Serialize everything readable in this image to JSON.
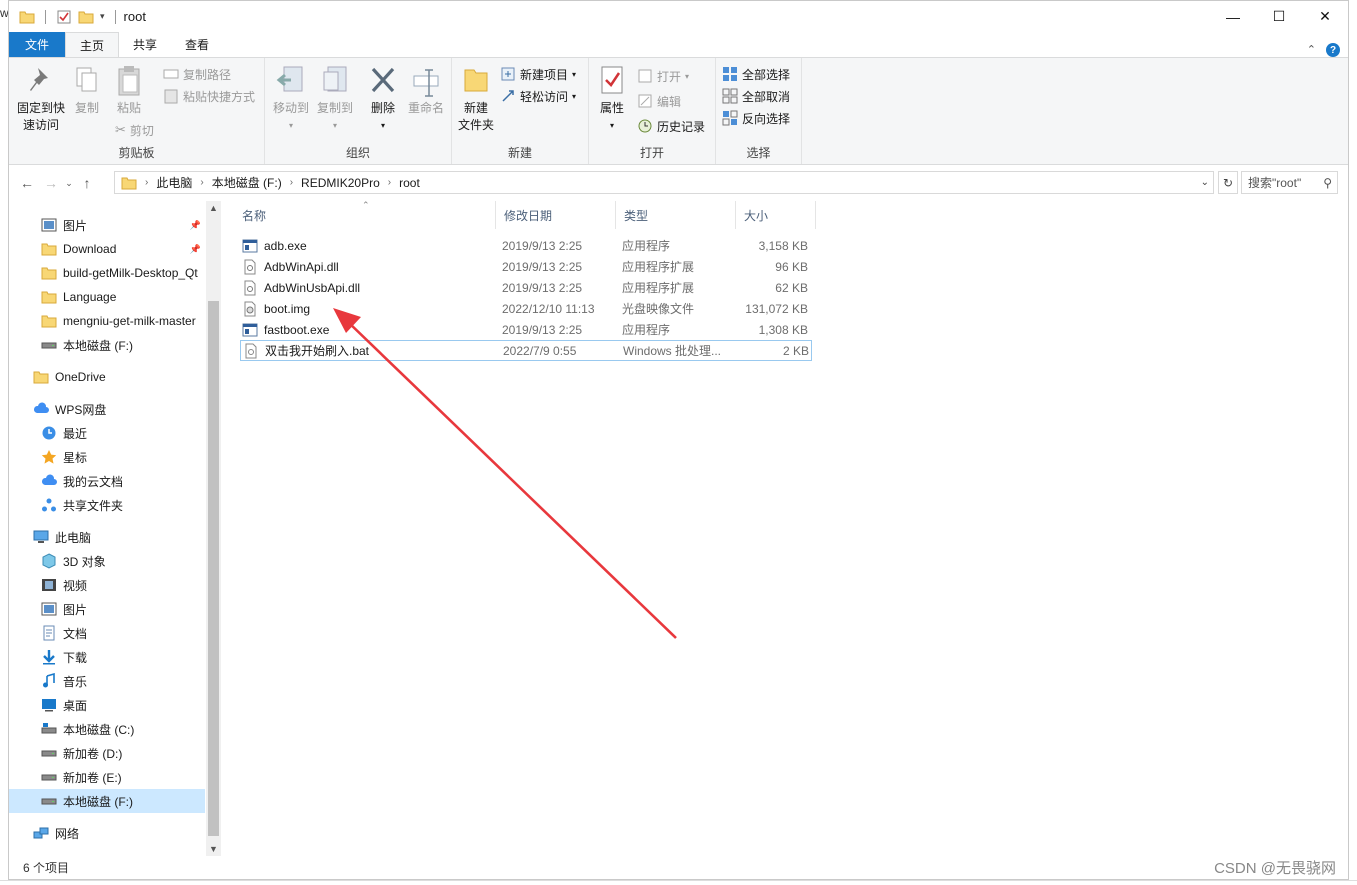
{
  "window": {
    "title": "root",
    "edge_letter": "w"
  },
  "tabs": {
    "file": "文件",
    "home": "主页",
    "share": "共享",
    "view": "查看",
    "help_glyph": "?"
  },
  "ribbon": {
    "clipboard": {
      "label": "剪贴板",
      "pin": "固定到快\n速访问",
      "pin_l1": "固定到快",
      "pin_l2": "速访问",
      "copy": "复制",
      "paste": "粘贴",
      "copy_path": "复制路径",
      "paste_shortcut": "粘贴快捷方式",
      "cut": "剪切"
    },
    "organize": {
      "label": "组织",
      "move_to": "移动到",
      "copy_to": "复制到",
      "delete": "删除",
      "rename": "重命名"
    },
    "new": {
      "label": "新建",
      "new_folder_l1": "新建",
      "new_folder_l2": "文件夹",
      "new_item": "新建项目",
      "easy_access": "轻松访问"
    },
    "open": {
      "label": "打开",
      "properties": "属性",
      "open": "打开",
      "edit": "编辑",
      "history": "历史记录"
    },
    "select": {
      "label": "选择",
      "select_all": "全部选择",
      "select_none": "全部取消",
      "invert": "反向选择"
    }
  },
  "address": {
    "crumbs": [
      "此电脑",
      "本地磁盘 (F:)",
      "REDMIK20Pro",
      "root"
    ],
    "search_placeholder": "搜索\"root\""
  },
  "nav": {
    "items": [
      {
        "label": "图片",
        "icon": "pictures-icon",
        "pinned": true
      },
      {
        "label": "Download",
        "icon": "folder-icon",
        "pinned": true
      },
      {
        "label": "build-getMilk-Desktop_Qt",
        "icon": "folder-icon",
        "pinned": false
      },
      {
        "label": "Language",
        "icon": "folder-icon",
        "pinned": false
      },
      {
        "label": "mengniu-get-milk-master",
        "icon": "folder-icon",
        "pinned": false
      },
      {
        "label": "本地磁盘 (F:)",
        "icon": "drive-icon",
        "pinned": false
      },
      {
        "label": "OneDrive",
        "icon": "folder-icon",
        "pinned": false
      },
      {
        "label": "WPS网盘",
        "icon": "cloud-icon",
        "pinned": false
      },
      {
        "label": "最近",
        "icon": "clock-icon",
        "pinned": false
      },
      {
        "label": "星标",
        "icon": "star-icon",
        "pinned": false
      },
      {
        "label": "我的云文档",
        "icon": "cloud-icon",
        "pinned": false
      },
      {
        "label": "共享文件夹",
        "icon": "share-icon",
        "pinned": false
      },
      {
        "label": "此电脑",
        "icon": "computer-icon",
        "pinned": false
      },
      {
        "label": "3D 对象",
        "icon": "cube-icon",
        "pinned": false
      },
      {
        "label": "视频",
        "icon": "video-icon",
        "pinned": false
      },
      {
        "label": "图片",
        "icon": "pictures-icon",
        "pinned": false
      },
      {
        "label": "文档",
        "icon": "document-icon",
        "pinned": false
      },
      {
        "label": "下载",
        "icon": "download-icon",
        "pinned": false
      },
      {
        "label": "音乐",
        "icon": "music-icon",
        "pinned": false
      },
      {
        "label": "桌面",
        "icon": "desktop-icon",
        "pinned": false
      },
      {
        "label": "本地磁盘 (C:)",
        "icon": "system-drive-icon",
        "pinned": false
      },
      {
        "label": "新加卷 (D:)",
        "icon": "drive-icon",
        "pinned": false
      },
      {
        "label": "新加卷 (E:)",
        "icon": "drive-icon",
        "pinned": false
      },
      {
        "label": "本地磁盘 (F:)",
        "icon": "drive-icon",
        "pinned": false,
        "selected": true
      },
      {
        "label": "网络",
        "icon": "network-icon",
        "pinned": false
      }
    ]
  },
  "columns": {
    "name": "名称",
    "date": "修改日期",
    "type": "类型",
    "size": "大小"
  },
  "files": [
    {
      "name": "adb.exe",
      "date": "2019/9/13 2:25",
      "type": "应用程序",
      "size": "3,158 KB",
      "icon": "exe-icon"
    },
    {
      "name": "AdbWinApi.dll",
      "date": "2019/9/13 2:25",
      "type": "应用程序扩展",
      "size": "96 KB",
      "icon": "dll-icon"
    },
    {
      "name": "AdbWinUsbApi.dll",
      "date": "2019/9/13 2:25",
      "type": "应用程序扩展",
      "size": "62 KB",
      "icon": "dll-icon"
    },
    {
      "name": "boot.img",
      "date": "2022/12/10 11:13",
      "type": "光盘映像文件",
      "size": "131,072 KB",
      "icon": "disc-image-icon"
    },
    {
      "name": "fastboot.exe",
      "date": "2019/9/13 2:25",
      "type": "应用程序",
      "size": "1,308 KB",
      "icon": "exe-icon"
    },
    {
      "name": "双击我开始刷入.bat",
      "date": "2022/7/9 0:55",
      "type": "Windows 批处理...",
      "size": "2 KB",
      "icon": "bat-icon",
      "focused": true
    }
  ],
  "status": {
    "count": "6 个项目"
  },
  "watermark": "CSDN @无畏骁网",
  "colors": {
    "accent": "#1979ca",
    "selection": "#cce8ff",
    "annotation_arrow": "#e8383d"
  }
}
